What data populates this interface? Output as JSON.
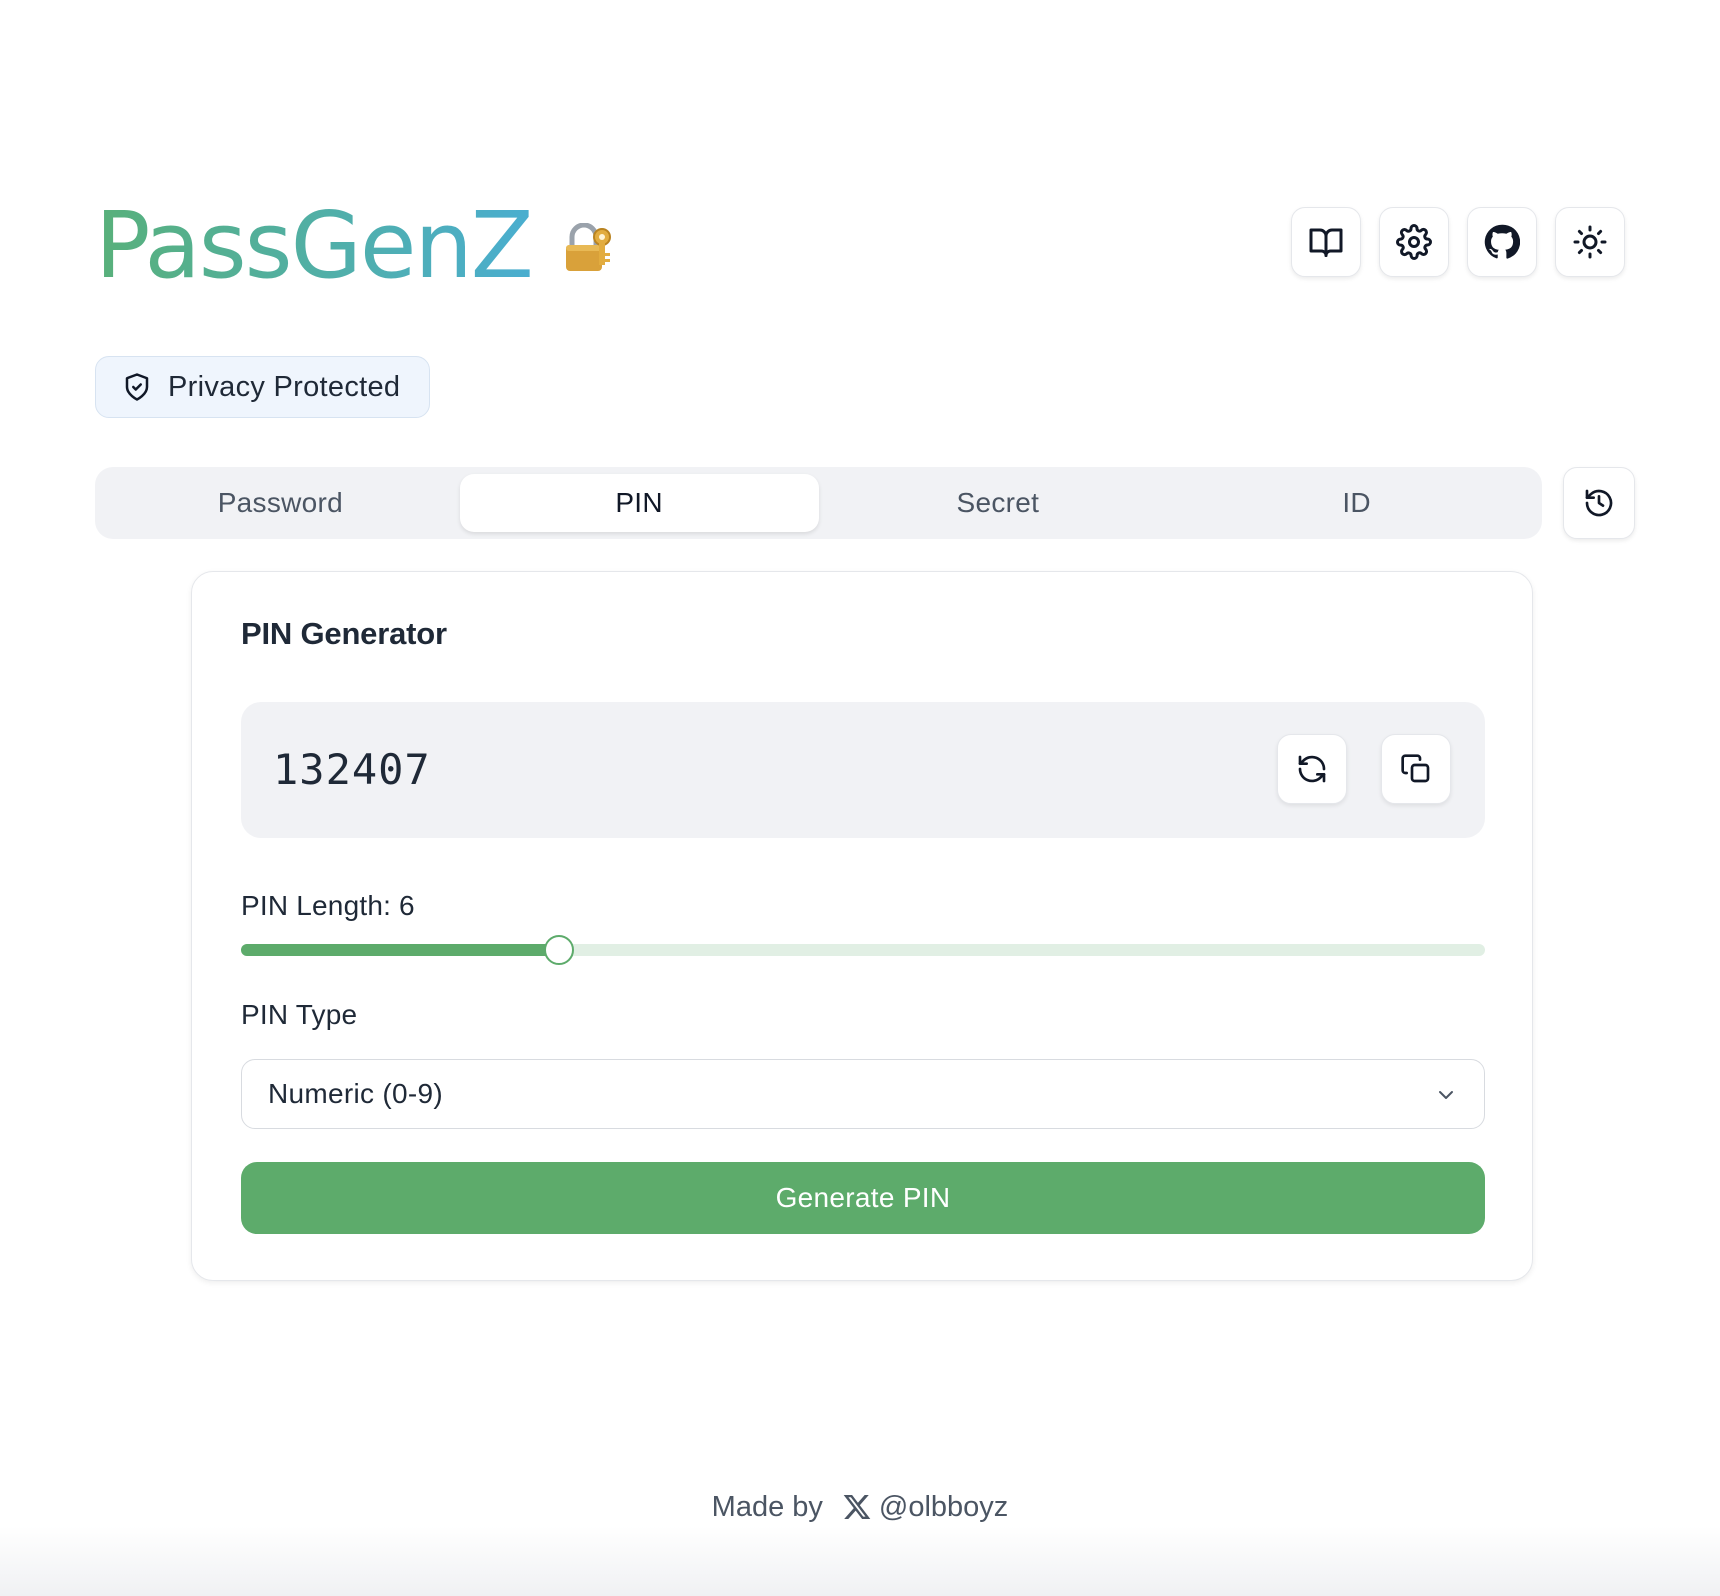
{
  "app": {
    "title": "PassGenZ",
    "logo_emoji": "lock-with-key-icon",
    "gradient_start": "#58b07a",
    "gradient_end": "#4aaed0"
  },
  "header_buttons": [
    {
      "icon": "book-icon"
    },
    {
      "icon": "gear-icon"
    },
    {
      "icon": "github-icon"
    },
    {
      "icon": "sun-icon"
    }
  ],
  "privacy_badge": {
    "icon": "shield-check-icon",
    "label": "Privacy Protected"
  },
  "tabs": [
    {
      "label": "Password",
      "active": false
    },
    {
      "label": "PIN",
      "active": true
    },
    {
      "label": "Secret",
      "active": false
    },
    {
      "label": "ID",
      "active": false
    }
  ],
  "history_button": {
    "icon": "history-icon"
  },
  "card": {
    "title": "PIN Generator",
    "pin_value": "132407",
    "refresh_icon": "refresh-icon",
    "copy_icon": "copy-icon",
    "length_label": "PIN Length: 6",
    "slider_fraction": 0.256,
    "type_label": "PIN Type",
    "type_selected": "Numeric (0-9)",
    "generate_label": "Generate PIN",
    "accent_color": "#5dab6b"
  },
  "footer": {
    "prefix": "Made by",
    "icon": "x-logo-icon",
    "handle": "@olbboyz"
  }
}
